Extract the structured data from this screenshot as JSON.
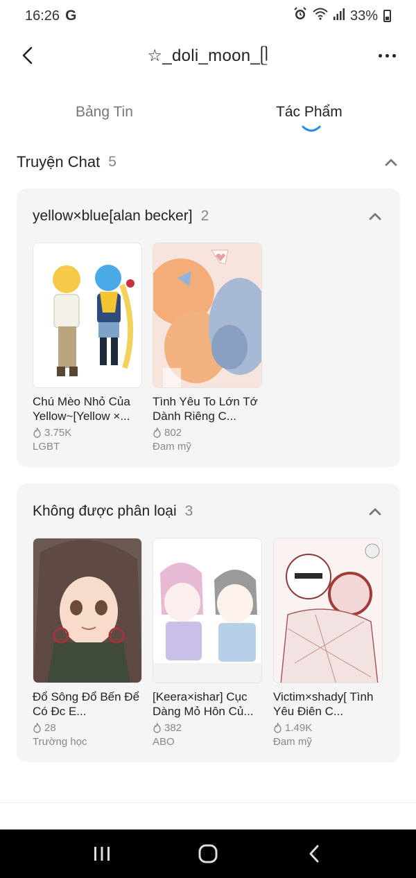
{
  "status_bar": {
    "time": "16:26",
    "g_label": "G",
    "battery": "33%"
  },
  "header": {
    "title": "☆_doli_moon_ᥫ"
  },
  "tabs": [
    {
      "label": "Bảng Tin"
    },
    {
      "label": "Tác Phẩm"
    }
  ],
  "section": {
    "title": "Truyện Chat",
    "count": "5"
  },
  "groups": [
    {
      "title": "yellow×blue[alan becker]",
      "count": "2",
      "stories": [
        {
          "title": "Chú Mèo Nhỏ Của Yellow~[Yellow ×...",
          "views": "3.75K",
          "genre": "LGBT"
        },
        {
          "title": "Tình Yêu To Lớn Tớ Dành Riêng C...",
          "views": "802",
          "genre": "Đam mỹ"
        }
      ]
    },
    {
      "title": "Không được phân loại",
      "count": "3",
      "stories": [
        {
          "title": "Đổ Sông Đổ Bến Để Có Đc E...",
          "views": "28",
          "genre": "Trường học"
        },
        {
          "title": "[Keera×ishar] Cục Dàng Mỏ Hôn Củ...",
          "views": "382",
          "genre": "ABO"
        },
        {
          "title": "Victim×shady[ Tình Yêu Điên C...",
          "views": "1.49K",
          "genre": "Đam mỹ"
        }
      ]
    }
  ]
}
